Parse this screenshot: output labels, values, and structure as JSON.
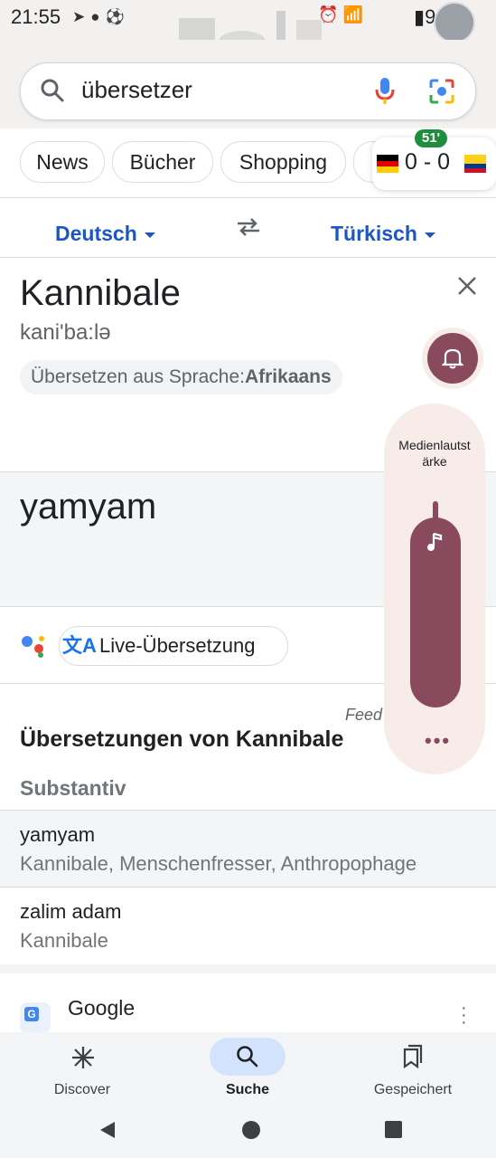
{
  "status": {
    "time": "21:55",
    "battery": "91 %"
  },
  "search": {
    "query": "übersetzer"
  },
  "chips": [
    "News",
    "Bücher",
    "Shopping"
  ],
  "score": {
    "minute": "51'",
    "result": "0 - 0"
  },
  "translate": {
    "source_lang": "Deutsch",
    "target_lang": "Türkisch",
    "source_text": "Kannibale",
    "phonetic": "kani'ba:lə",
    "detect_prefix": "Übersetzen aus Sprache:",
    "detect_lang": "Afrikaans",
    "target_text": "yamyam",
    "live_label": "Live-Übersetzung",
    "feedback": "Feed",
    "section_title": "Übersetzungen von Kannibale",
    "pos": "Substantiv",
    "rows": [
      {
        "word": "yamyam",
        "synonyms": "Kannibale, Menschenfresser, Anthropophage"
      },
      {
        "word": "zalim adam",
        "synonyms": "Kannibale"
      }
    ]
  },
  "result": {
    "site": "Google"
  },
  "volume": {
    "label_line1": "Medienlautst",
    "label_line2": "ärke",
    "level": 0.95
  },
  "nav": {
    "discover": "Discover",
    "search": "Suche",
    "saved": "Gespeichert"
  },
  "icons": [
    "telegram-icon",
    "messenger-icon",
    "soccer-icon",
    "alarm-icon",
    "wifi-icon",
    "signal-icon",
    "battery-icon",
    "search-icon",
    "mic-icon",
    "lens-icon",
    "swap-icon",
    "close-icon",
    "bell-icon",
    "music-note-icon",
    "more-icon",
    "assistant-icon",
    "translate-icon",
    "discover-icon",
    "saved-icon",
    "back-icon",
    "home-icon",
    "recents-icon"
  ],
  "colors": {
    "accent": "#1a56c4",
    "volume": "#8a4a5e",
    "nav_pill": "#d3e3fd",
    "badge": "#1e8e3e"
  }
}
